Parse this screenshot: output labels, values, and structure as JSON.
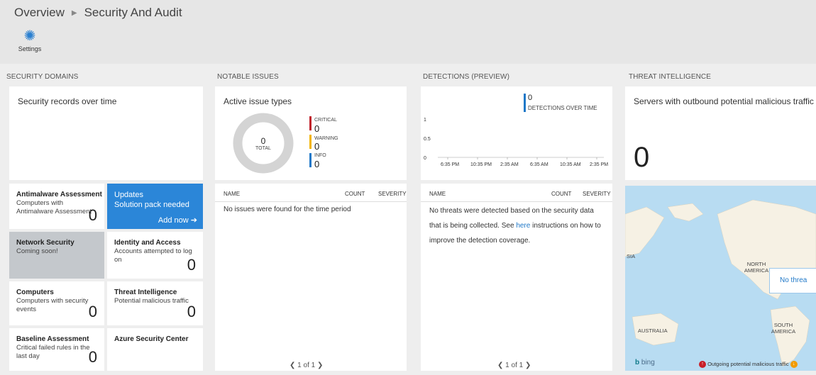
{
  "breadcrumb": {
    "root": "Overview",
    "current": "Security And Audit"
  },
  "toolbar": {
    "settings_label": "Settings"
  },
  "columns": {
    "security_domains": "SECURITY DOMAINS",
    "notable_issues": "NOTABLE ISSUES",
    "detections": "DETECTIONS (PREVIEW)",
    "threat_intel": "THREAT INTELLIGENCE"
  },
  "security_records": {
    "title": "Security records over time"
  },
  "tiles": {
    "antimalware": {
      "title": "Antimalware Assessment",
      "subtitle": "Computers with Antimalware Assessment",
      "count": "0"
    },
    "updates": {
      "title": "Updates",
      "subtitle": "Solution pack needed",
      "action": "Add now"
    },
    "network": {
      "title": "Network Security",
      "subtitle": "Coming soon!"
    },
    "identity": {
      "title": "Identity and Access",
      "subtitle": "Accounts attempted to log on",
      "count": "0"
    },
    "computers": {
      "title": "Computers",
      "subtitle": "Computers with security events",
      "count": "0"
    },
    "threat": {
      "title": "Threat Intelligence",
      "subtitle": "Potential malicious traffic",
      "count": "0"
    },
    "baseline": {
      "title": "Baseline Assessment",
      "subtitle": "Critical failed rules in the last day",
      "count": "0"
    },
    "asc": {
      "title": "Azure Security Center"
    }
  },
  "active_issues": {
    "title": "Active issue types",
    "total_value": "0",
    "total_label": "TOTAL",
    "legend": [
      {
        "label": "CRITICAL",
        "value": "0",
        "color": "#c0202a"
      },
      {
        "label": "WARNING",
        "value": "0",
        "color": "#f2b400"
      },
      {
        "label": "INFO",
        "value": "0",
        "color": "#1f78c8"
      }
    ]
  },
  "issues_grid": {
    "col_name": "NAME",
    "col_count": "COUNT",
    "col_severity": "SEVERITY",
    "empty_message": "No issues were found for the time period",
    "pager": "1 of 1"
  },
  "detections_chart": {
    "legend_value": "0",
    "legend_label": "DETECTIONS OVER TIME",
    "accent": "#1f78c8"
  },
  "chart_data": {
    "type": "line",
    "x": [
      "6:35 PM",
      "10:35 PM",
      "2:35 AM",
      "6:35 AM",
      "10:35 AM",
      "2:35 PM"
    ],
    "series": [],
    "yticks": [
      "1",
      "0.5",
      "0"
    ],
    "ylim": [
      0,
      1
    ],
    "title": "",
    "xlabel": "",
    "ylabel": ""
  },
  "detections_grid": {
    "col_name": "NAME",
    "col_count": "COUNT",
    "col_severity": "SEVERITY",
    "msg_part1": "No threats were detected based on the security data that is being collected. See",
    "msg_link": "here",
    "msg_part2": "instructions on how to improve the detection coverage.",
    "pager": "1 of 1"
  },
  "servers_outbound": {
    "title": "Servers with outbound potential malicious traffic",
    "count": "0"
  },
  "map": {
    "labels": {
      "asia": "SIA",
      "north_america": "NORTH AMERICA",
      "south_america": "SOUTH AMERICA",
      "australia": "AUSTRALIA"
    },
    "no_threat": "No threa",
    "bing": "bing",
    "legend": "Outgoing potential malicious traffic"
  }
}
